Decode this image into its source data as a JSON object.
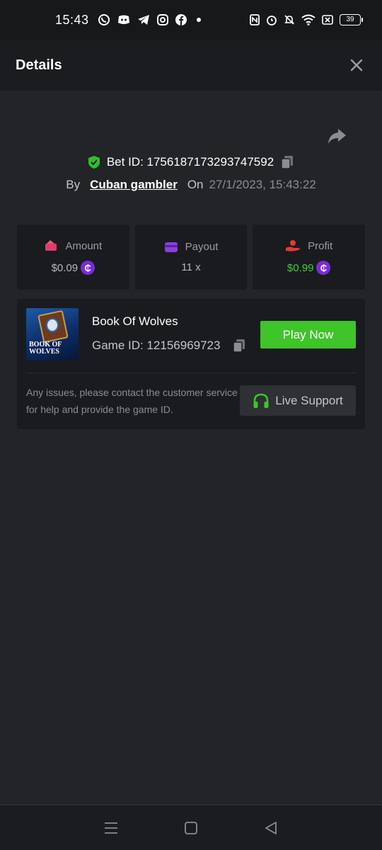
{
  "status_bar": {
    "time": "15:43",
    "battery": "39",
    "app_icons": [
      "whatsapp-icon",
      "discord-icon",
      "telegram-icon",
      "instagram-icon",
      "facebook-icon",
      "dot-icon"
    ],
    "system_icons": [
      "nfc-icon",
      "alarm-icon",
      "mute-icon",
      "wifi-icon",
      "x-box-icon"
    ]
  },
  "header": {
    "title": "Details"
  },
  "bet": {
    "id_text": "Bet ID: 1756187173293747592",
    "by_label": "By",
    "user": "Cuban gambler",
    "on_label": "On",
    "date": "27/1/2023, 15:43:22"
  },
  "stats": {
    "amount": {
      "label": "Amount",
      "value": "$0.09"
    },
    "payout": {
      "label": "Payout",
      "value": "11 x"
    },
    "profit": {
      "label": "Profit",
      "value": "$0.99"
    },
    "coin_symbol": "₵"
  },
  "game": {
    "name": "Book Of Wolves",
    "id_text": "Game ID: 12156969723",
    "thumb_text": "BOOK OF\nWOLVES",
    "play_label": "Play Now",
    "issue_text": "Any issues, please contact the customer service for help and provide the game ID.",
    "support_label": "Live Support"
  },
  "colors": {
    "accent_green": "#3fc42a",
    "profit_green": "#3fcb3a",
    "coin_purple": "#7b2bd6",
    "background": "#232427",
    "card": "#1a1b1e"
  }
}
